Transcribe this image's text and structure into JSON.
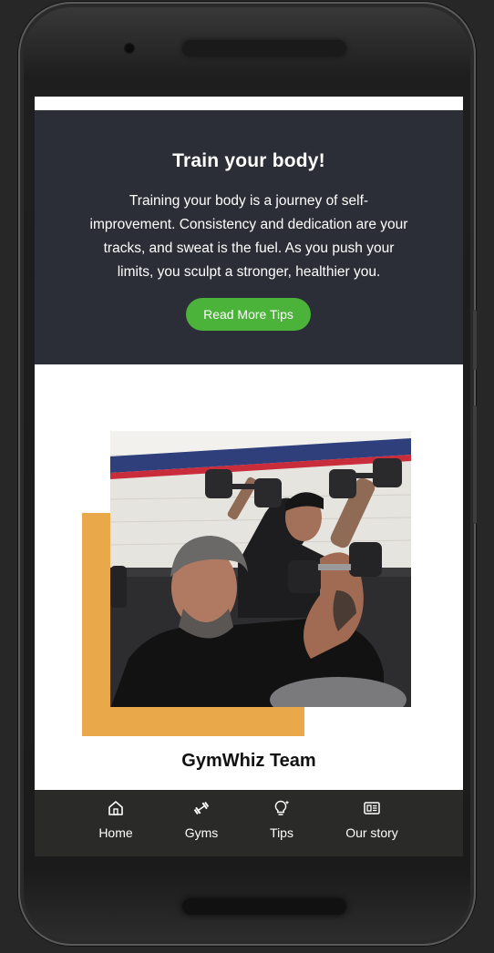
{
  "hero": {
    "title": "Train your body!",
    "body": "Training your body is a journey of self-improvement. Consistency and dedication are your tracks, and sweat is the fuel. As you push your limits, you sculpt a stronger, healthier you.",
    "button_label": "Read More Tips"
  },
  "team": {
    "caption": "GymWhiz Team"
  },
  "tabs": [
    {
      "label": "Home",
      "icon": "home-icon"
    },
    {
      "label": "Gyms",
      "icon": "dumbbell-icon"
    },
    {
      "label": "Tips",
      "icon": "lightbulb-icon"
    },
    {
      "label": "Our story",
      "icon": "newspaper-icon"
    }
  ],
  "colors": {
    "hero_bg": "#2b2e36",
    "button": "#4bb33a",
    "accent": "#e9a84a",
    "tabbar": "#2a2a28"
  }
}
